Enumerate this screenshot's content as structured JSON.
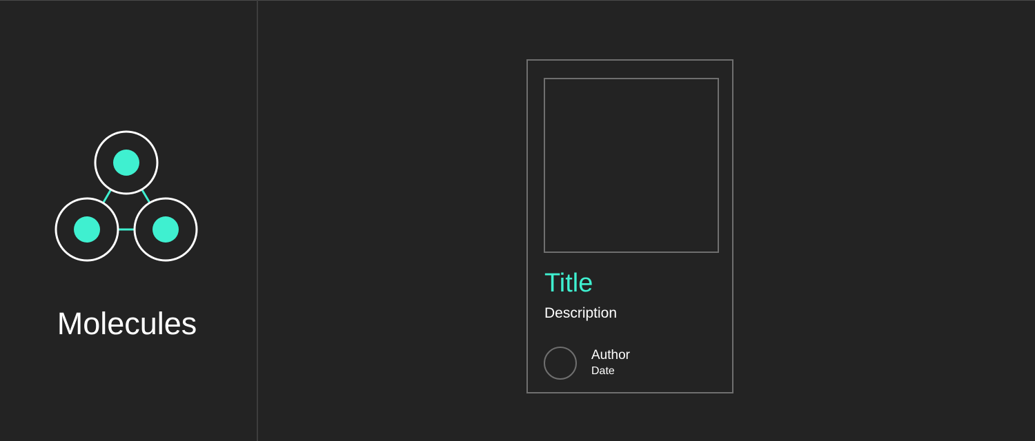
{
  "colors": {
    "background": "#232323",
    "accent": "#3ff0d0",
    "outline": "#6f6f6f",
    "text": "#ffffff"
  },
  "sidebar": {
    "icon": "molecules-icon",
    "label": "Molecules"
  },
  "card": {
    "image_icon": "image-placeholder",
    "title": "Title",
    "description": "Description",
    "avatar_icon": "avatar-placeholder",
    "author": "Author",
    "date": "Date"
  }
}
